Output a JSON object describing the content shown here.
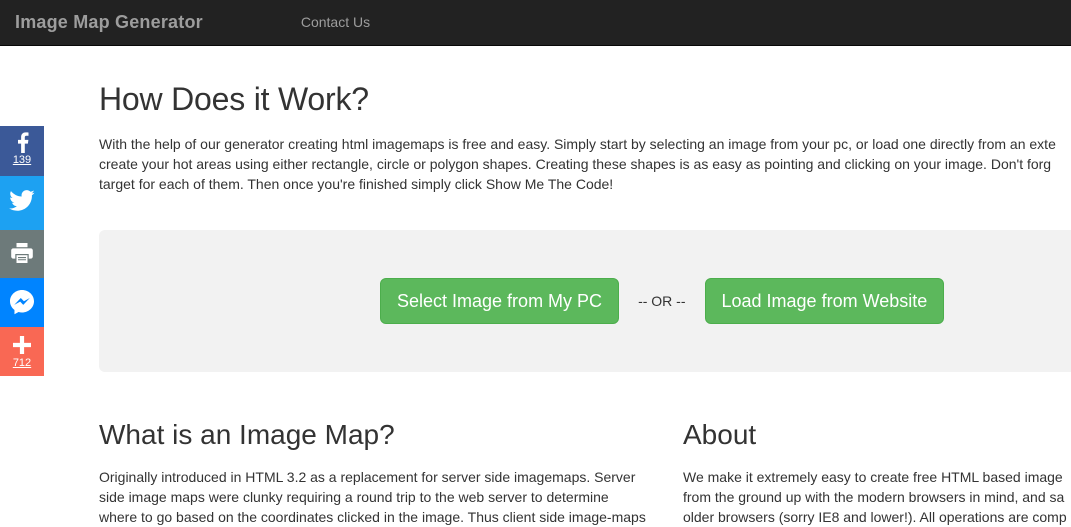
{
  "navbar": {
    "brand": "Image Map Generator",
    "links": [
      {
        "label": "Contact Us",
        "name": "nav-contact-us"
      }
    ]
  },
  "social": {
    "items": [
      {
        "name": "facebook",
        "icon": "facebook-icon",
        "count": "139",
        "color": "#3b5998"
      },
      {
        "name": "twitter",
        "icon": "twitter-icon",
        "count": "",
        "color": "#1da1f2"
      },
      {
        "name": "print",
        "icon": "printer-icon",
        "count": "",
        "color": "#6d7a7a"
      },
      {
        "name": "messenger",
        "icon": "messenger-icon",
        "count": "",
        "color": "#0084ff"
      },
      {
        "name": "addthis",
        "icon": "plus-icon",
        "count": "712",
        "color": "#f96854"
      }
    ]
  },
  "main": {
    "heading": "How Does it Work?",
    "intro_lines": [
      "With the help of our generator creating html imagemaps is free and easy. Simply start by selecting an image from your pc, or load one directly from an exte",
      "create your hot areas using either rectangle, circle or polygon shapes. Creating these shapes is as easy as pointing and clicking on your image. Don't forg",
      "target for each of them. Then once you're finished simply click Show Me The Code!"
    ]
  },
  "panel": {
    "select_button": "Select Image from My PC",
    "separator": "-- OR --",
    "load_button": "Load Image from Website",
    "background": "#f2f2f2",
    "button_color": "#5cb85c"
  },
  "columns": {
    "left": {
      "title": "What is an Image Map?",
      "lines": [
        "Originally introduced in HTML 3.2 as a replacement for server side imagemaps. Server",
        "side image maps were clunky requiring a round trip to the web server to determine",
        "where to go based on the coordinates clicked in the image. Thus client side image-maps"
      ]
    },
    "right": {
      "title": "About",
      "lines": [
        "We make it extremely easy to create free HTML based image",
        "from the ground up with the modern browsers in mind, and sa",
        "older browsers (sorry IE8 and lower!). All operations are comp"
      ]
    }
  }
}
